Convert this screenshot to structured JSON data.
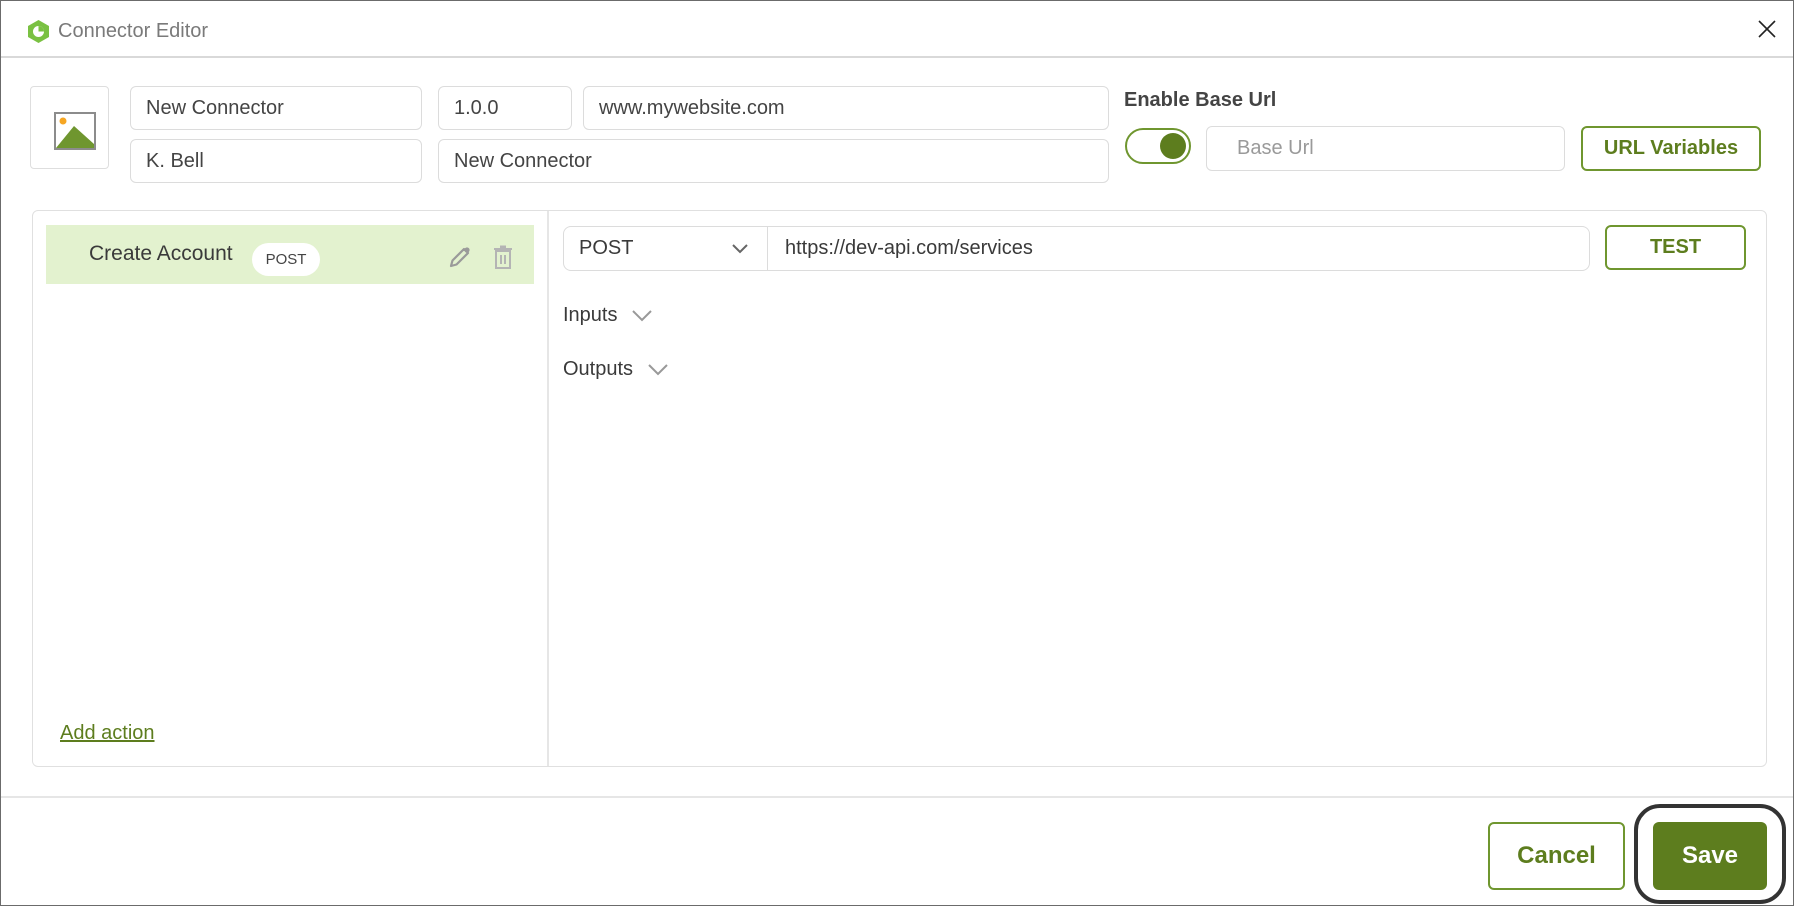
{
  "window": {
    "title": "Connector Editor",
    "logo_icon": "connector-hexagon-logo",
    "close_icon": "close-icon"
  },
  "header": {
    "image_icon": "image-placeholder-icon",
    "name": "New Connector",
    "version": "1.0.0",
    "website": "www.mywebsite.com",
    "author": "K. Bell",
    "description": "New Connector",
    "enable_base_url_label": "Enable Base Url",
    "enable_base_url_on": true,
    "base_url_value": "",
    "base_url_placeholder": "Base Url",
    "url_variables_label": "URL Variables"
  },
  "actions": {
    "items": [
      {
        "name": "Create Account",
        "method": "POST",
        "selected": true
      }
    ],
    "add_action_label": "Add action"
  },
  "request": {
    "method": "POST",
    "url": "https://dev-api.com/services",
    "test_label": "TEST",
    "sections": [
      {
        "label": "Inputs",
        "expanded": false
      },
      {
        "label": "Outputs",
        "expanded": false
      }
    ]
  },
  "footer": {
    "cancel_label": "Cancel",
    "save_label": "Save"
  },
  "colors": {
    "brand_green": "#5d7d1e",
    "border_green": "#6f962f",
    "selected_row": "#e3f2cf",
    "logo_green": "#7ac142"
  }
}
